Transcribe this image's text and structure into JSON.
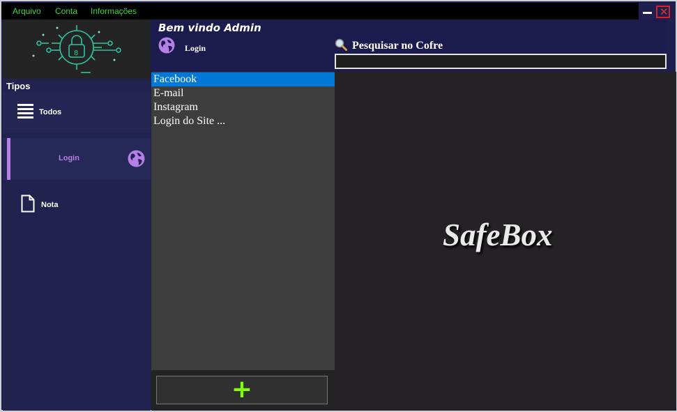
{
  "menu": {
    "items": [
      "Arquivo",
      "Conta",
      "Informações"
    ]
  },
  "window": {
    "close_glyph": "✕",
    "minimize_glyph": "—"
  },
  "sidebar": {
    "section_title": "Tipos",
    "items": [
      {
        "label": "Todos",
        "icon": "menu-lines-icon"
      },
      {
        "label": "Login",
        "icon": "globe-icon",
        "selected": true
      },
      {
        "label": "Nota",
        "icon": "document-icon"
      }
    ]
  },
  "header": {
    "welcome": "Bem vindo Admin",
    "current_type": "Login",
    "search_label": "Pesquisar no Cofre",
    "search_value": ""
  },
  "list": {
    "items": [
      "Facebook",
      "E-mail",
      "Instagram",
      "Login do Site ..."
    ],
    "selected_index": 0,
    "add_glyph": "+"
  },
  "main": {
    "brand": "SafeBox"
  },
  "colors": {
    "menu_text": "#3dd83d",
    "accent_purple": "#b57fe6",
    "selection_blue": "#0078d7",
    "add_green": "#7fff00",
    "close_red": "#d8222a"
  }
}
